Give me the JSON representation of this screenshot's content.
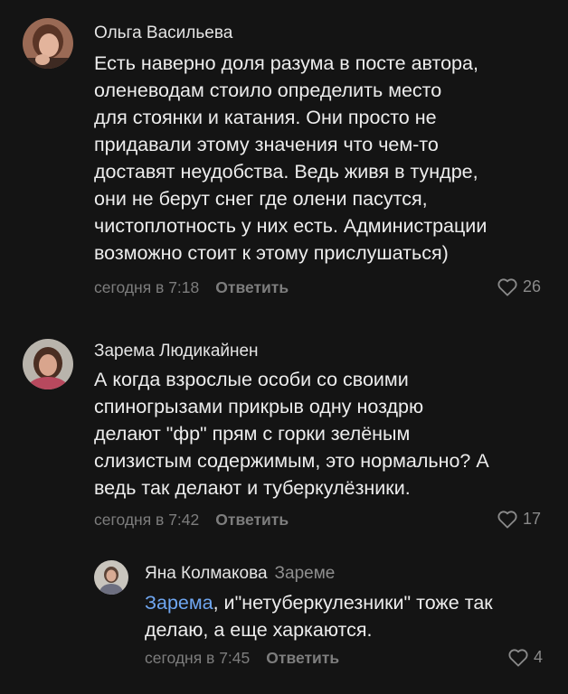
{
  "comments": [
    {
      "author": "Ольга Васильева",
      "text": "Есть наверно доля разума в посте автора,\nоленеводам стоило определить место\nдля стоянки и катания. Они просто не\nпридавали этому значения что чем-то\nдоставят неудобства. Ведь живя в тундре,\nони не берут снег где олени пасутся,\nчистоплотность у них есть. Администрации\nвозможно стоит к этому прислушаться)",
      "time": "сегодня в 7:18",
      "reply_label": "Ответить",
      "likes": "26",
      "avatar_icon": "user-photo-avatar"
    },
    {
      "author": "Зарема Людикайнен",
      "text": "А когда взрослые особи со своими\nспиногрызами прикрыв одну ноздрю\nделают \"фр\" прям с горки зелёным\nслизистым содержимым, это нормально? А\nведь так делают и туберкулёзники.",
      "time": "сегодня в 7:42",
      "reply_label": "Ответить",
      "likes": "17",
      "avatar_icon": "user-photo-avatar"
    }
  ],
  "reply": {
    "author": "Яна Колмакова",
    "reply_to": "Зареме",
    "mention": "Зарема",
    "text": ", и\"нетуберкулезники\" тоже так\nделаю, а еще харкаются.",
    "time": "сегодня в 7:45",
    "reply_label": "Ответить",
    "likes": "4",
    "avatar_icon": "user-photo-avatar"
  },
  "icons": {
    "like": "heart-outline-icon"
  },
  "colors": {
    "background": "#141414",
    "text": "#ededed",
    "muted": "#7d7d7d",
    "mention": "#6fa6f0"
  }
}
